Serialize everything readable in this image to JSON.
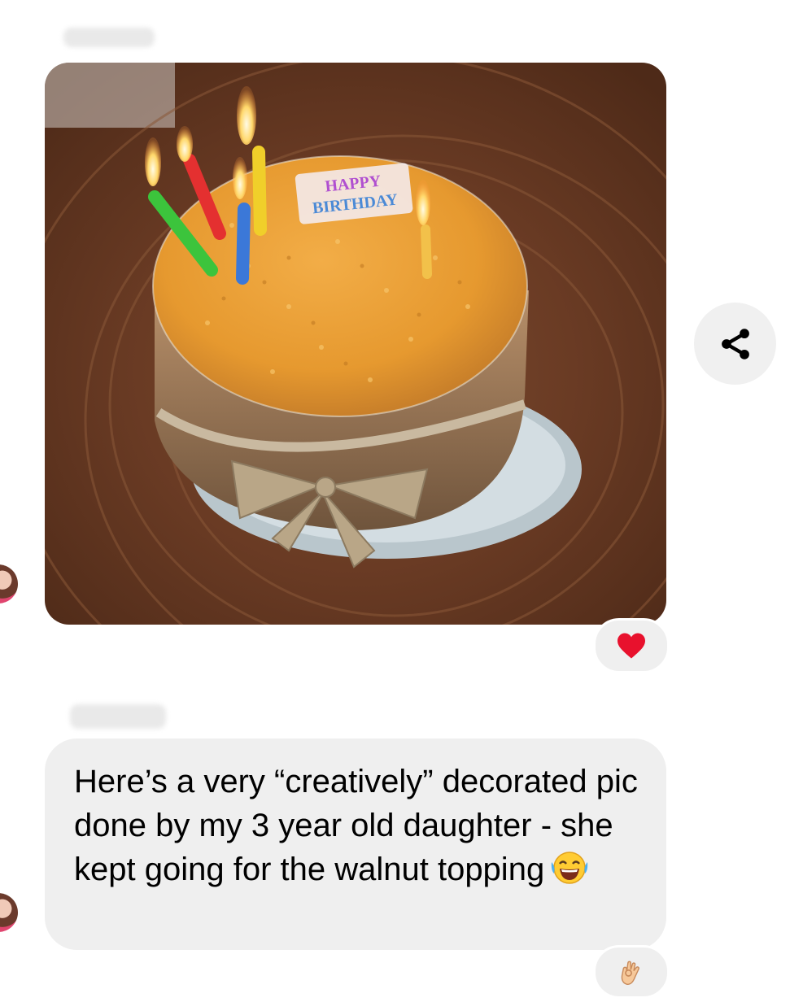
{
  "thread": {
    "messages": [
      {
        "type": "image",
        "image_caption_on_cake": "HAPPY BIRTHDAY",
        "reaction": "heart"
      },
      {
        "type": "text",
        "text": "Here’s a very “creatively” decorated pic done by my 3 year old daughter - she kept going for the walnut topping",
        "inline_emoji": "face-with-tears-of-joy",
        "reaction": "ok-hand"
      }
    ]
  },
  "icons": {
    "share": "share-icon",
    "heart": "heart-icon",
    "ok_hand": "ok-hand-icon",
    "laugh": "face-with-tears-of-joy-icon"
  },
  "colors": {
    "bubble_bg": "#efefef",
    "share_bg": "#f0f0f0",
    "heart": "#e8112d"
  }
}
